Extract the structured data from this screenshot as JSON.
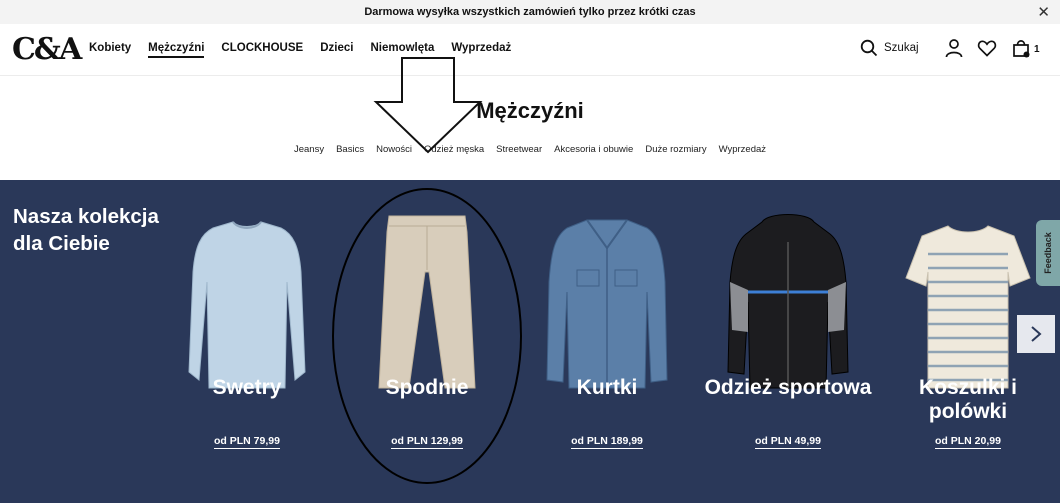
{
  "promo": {
    "text": "Darmowa wysyłka wszystkich zamówień tylko przez krótki czas",
    "close_label": "✕"
  },
  "header": {
    "logo": "C&A",
    "nav": [
      {
        "label": "Kobiety"
      },
      {
        "label": "Mężczyźni",
        "active": true
      },
      {
        "label": "CLOCKHOUSE"
      },
      {
        "label": "Dzieci"
      },
      {
        "label": "Niemowlęta"
      },
      {
        "label": "Wyprzedaż"
      }
    ],
    "search_label": "Szukaj",
    "cart_count": "1",
    "icons": [
      "search-icon",
      "account-icon",
      "heart-icon",
      "bag-icon"
    ]
  },
  "category": {
    "title": "Mężczyźni",
    "subnav": [
      "Jeansy",
      "Basics",
      "Nowości",
      "Odzież męska",
      "Streetwear",
      "Akcesoria i obuwie",
      "Duże rozmiary",
      "Wyprzedaż"
    ]
  },
  "collection": {
    "title": "Nasza kolekcja dla Ciebie",
    "items": [
      {
        "name": "Swetry",
        "price": "od PLN 79,99"
      },
      {
        "name": "Spodnie",
        "price": "od PLN 129,99"
      },
      {
        "name": "Kurtki",
        "price": "od PLN 189,99"
      },
      {
        "name": "Odzież sportowa",
        "price": "od PLN 49,99"
      },
      {
        "name": "Koszulki i polówki",
        "price": "od PLN 20,99"
      }
    ],
    "next_label": "›",
    "feedback_label": "Feedback"
  },
  "colors": {
    "collection_bg": "#2a3859",
    "promo_bg": "#f3f3f3",
    "feedback_bg": "#7fa7a8"
  }
}
